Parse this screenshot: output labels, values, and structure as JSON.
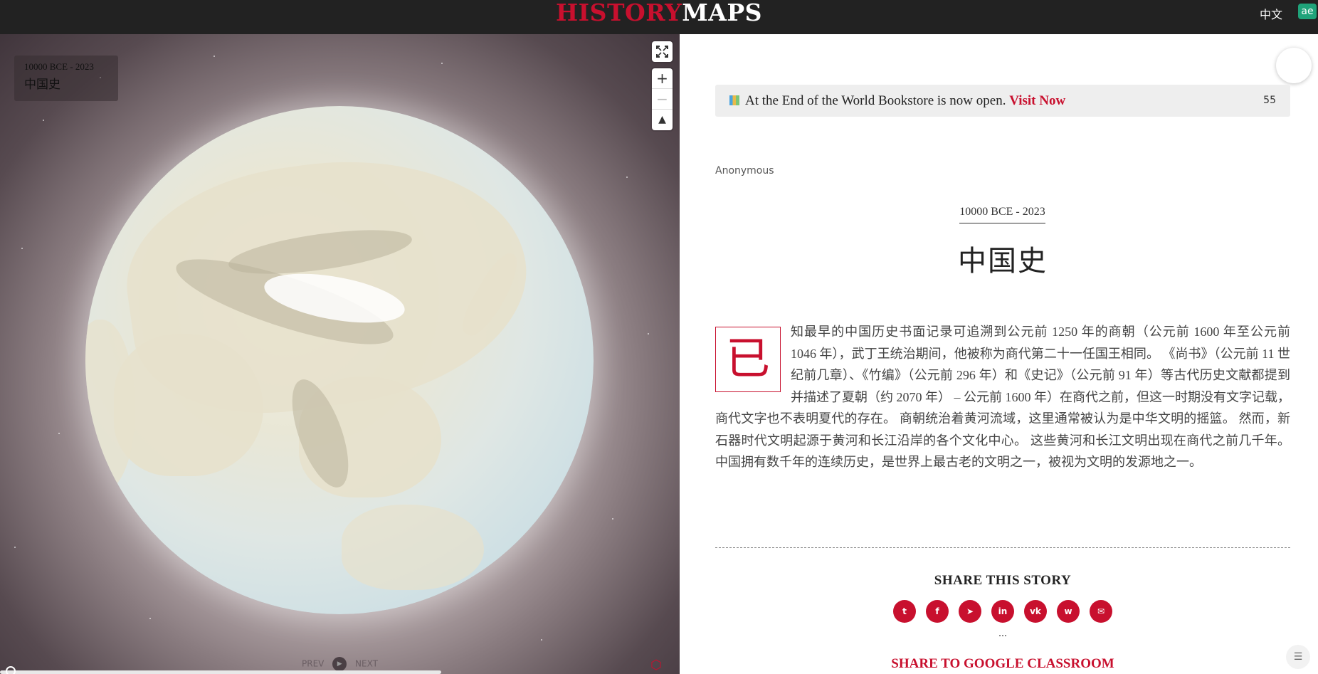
{
  "header": {
    "logo_part1": "HISTORY",
    "logo_part2": "MAPS",
    "language": "中文",
    "language_badge": "ae"
  },
  "map": {
    "timebox_range": "10000 BCE - 2023",
    "timebox_title": "中国史",
    "fullscreen_icon": "expand-icon",
    "zoom_in": "+",
    "zoom_out": "−",
    "compass": "▲",
    "prev_label": "PREV",
    "next_label": "NEXT",
    "accent": "#c8102e"
  },
  "article": {
    "banner_text": "At the End of the World Bookstore is now open.",
    "banner_link": "Visit Now",
    "banner_count": "55",
    "author": "Anonymous",
    "date_range": "10000 BCE - 2023",
    "title": "中国史",
    "dropcap": "已",
    "body": "知最早的中国历史书面记录可追溯到公元前 1250 年的商朝（公元前 1600 年至公元前 1046 年），武丁王统治期间，他被称为商代第二十一任国王相同。 《尚书》（公元前 11 世纪前几章）、《竹编》（公元前 296 年）和《史记》（公元前 91 年）等古代历史文献都提到并描述了夏朝（约 2070 年） – 公元前 1600 年）在商代之前，但这一时期没有文字记载，商代文字也不表明夏代的存在。 商朝统治着黄河流域，这里通常被认为是中华文明的摇篮。 然而，新石器时代文明起源于黄河和长江沿岸的各个文化中心。 这些黄河和长江文明出现在商代之前几千年。 中国拥有数千年的连续历史，是世界上最古老的文明之一，被视为文明的发源地之一。",
    "share_title": "SHARE THIS STORY",
    "share_icons": [
      "twitter-icon",
      "facebook-icon",
      "telegram-icon",
      "linkedin-icon",
      "vk-icon",
      "weibo-icon",
      "email-icon"
    ],
    "share_glyphs": [
      "t",
      "f",
      "➤",
      "in",
      "vk",
      "w",
      "✉"
    ],
    "more": "...",
    "classroom": "SHARE TO GOOGLE CLASSROOM",
    "list_icon": "☰"
  }
}
